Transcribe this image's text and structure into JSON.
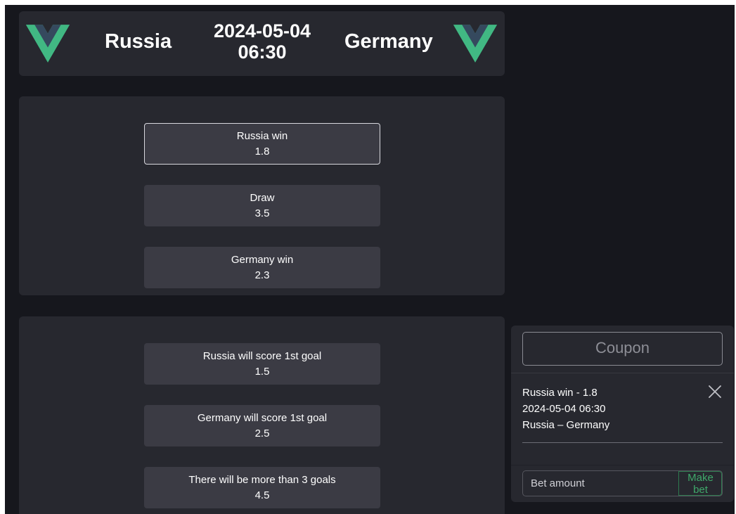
{
  "match": {
    "home_team": "Russia",
    "away_team": "Germany",
    "date": "2024-05-04",
    "time": "06:30"
  },
  "colors": {
    "logo_green": "#41b883",
    "logo_dark": "#35495e",
    "accent_green": "#3fa86a"
  },
  "market_main": [
    {
      "label": "Russia win",
      "odd": "1.8",
      "selected": true
    },
    {
      "label": "Draw",
      "odd": "3.5",
      "selected": false
    },
    {
      "label": "Germany win",
      "odd": "2.3",
      "selected": false
    }
  ],
  "market_goals": [
    {
      "label": "Russia will score 1st goal",
      "odd": "1.5"
    },
    {
      "label": "Germany will score 1st goal",
      "odd": "2.5"
    },
    {
      "label": "There will be more than 3 goals",
      "odd": "4.5"
    }
  ],
  "coupon": {
    "title": "Coupon",
    "item": {
      "bet": "Russia win - 1.8",
      "datetime": "2024-05-04 06:30",
      "teams": "Russia – Germany"
    },
    "amount_placeholder": "Bet amount",
    "submit_label": "Make bet"
  }
}
